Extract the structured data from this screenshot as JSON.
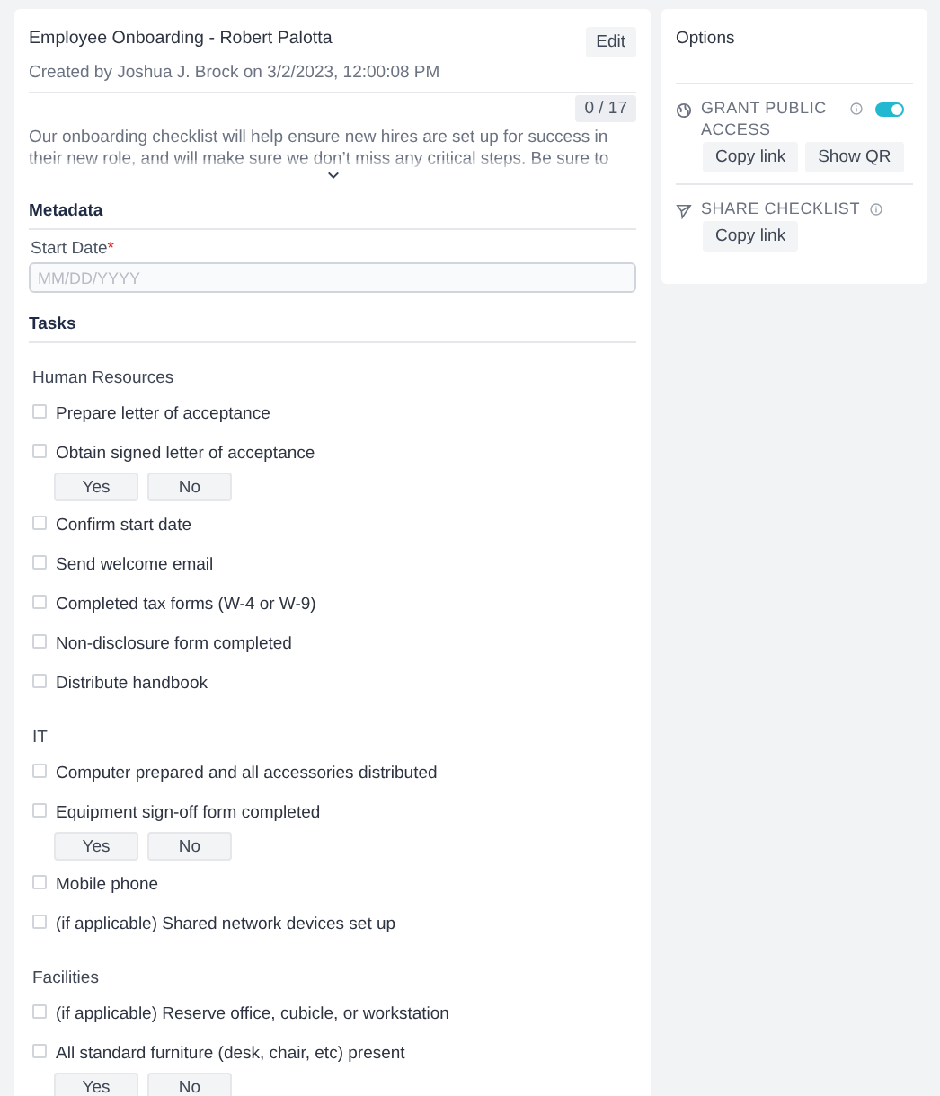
{
  "checklist": {
    "title": "Employee Onboarding - Robert Palotta",
    "edit_button": "Edit",
    "subtitle": "Created by Joshua J. Brock on 3/2/2023, 12:00:08 PM",
    "progress": "0 / 17",
    "description": "Our onboarding checklist will help ensure new hires are set up for success in their new role, and will make sure we don’t miss any critical steps. Be sure to",
    "expanded": false
  },
  "metadata": {
    "heading": "Metadata",
    "fields": [
      {
        "label": "Start Date",
        "required_mark": "*",
        "placeholder": "MM/DD/YYYY"
      }
    ]
  },
  "tasks": {
    "heading": "Tasks",
    "sections": [
      {
        "name": "Human Resources",
        "items": [
          {
            "kind": "checkbox",
            "label": "Prepare letter of acceptance",
            "checked": false
          },
          {
            "kind": "yesno",
            "label": "Obtain signed letter of acceptance",
            "checked": false,
            "yes": "Yes",
            "no": "No"
          },
          {
            "kind": "checkbox",
            "label": "Confirm start date",
            "checked": false
          },
          {
            "kind": "checkbox",
            "label": "Send welcome email",
            "checked": false
          },
          {
            "kind": "checkbox",
            "label": "Completed tax forms (W-4 or W-9)",
            "checked": false
          },
          {
            "kind": "checkbox",
            "label": "Non-disclosure form completed",
            "checked": false
          },
          {
            "kind": "checkbox",
            "label": "Distribute handbook",
            "checked": false
          }
        ]
      },
      {
        "name": "IT",
        "items": [
          {
            "kind": "checkbox",
            "label": "Computer prepared and all accessories distributed",
            "checked": false
          },
          {
            "kind": "yesno",
            "label": "Equipment sign-off form completed",
            "checked": false,
            "yes": "Yes",
            "no": "No"
          },
          {
            "kind": "checkbox",
            "label": "Mobile phone",
            "checked": false
          },
          {
            "kind": "checkbox",
            "label": "(if applicable) Shared network devices set up",
            "checked": false
          }
        ]
      },
      {
        "name": "Facilities",
        "items": [
          {
            "kind": "checkbox",
            "label": "(if applicable) Reserve office, cubicle, or workstation",
            "checked": false
          },
          {
            "kind": "yesno",
            "label": "All standard furniture (desk, chair, etc) present",
            "checked": false,
            "yes": "Yes",
            "no": "No"
          }
        ]
      }
    ]
  },
  "options": {
    "title": "Options",
    "groups": [
      {
        "kind": "globe",
        "label": "GRANT PUBLIC ACCESS",
        "on": true,
        "buttons": [
          "Copy link",
          "Show QR"
        ]
      },
      {
        "kind": "send",
        "label": "SHARE CHECKLIST",
        "buttons": [
          "Copy link"
        ]
      }
    ]
  }
}
